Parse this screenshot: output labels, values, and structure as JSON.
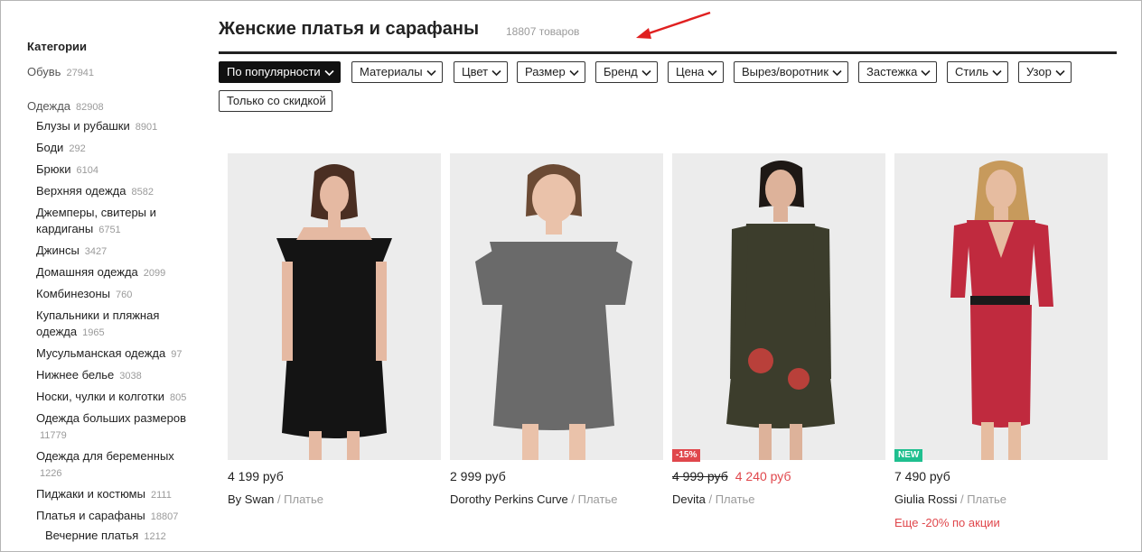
{
  "sidebar": {
    "title": "Категории",
    "items": [
      {
        "label": "Обувь",
        "count": "27941"
      },
      {
        "label": "Одежда",
        "count": "82908"
      },
      {
        "label": "Блузы и рубашки",
        "count": "8901"
      },
      {
        "label": "Боди",
        "count": "292"
      },
      {
        "label": "Брюки",
        "count": "6104"
      },
      {
        "label": "Верхняя одежда",
        "count": "8582"
      },
      {
        "label": "Джемперы, свитеры и",
        "label2": "кардиганы",
        "count": "6751"
      },
      {
        "label": "Джинсы",
        "count": "3427"
      },
      {
        "label": "Домашняя одежда",
        "count": "2099"
      },
      {
        "label": "Комбинезоны",
        "count": "760"
      },
      {
        "label": "Купальники и пляжная",
        "label2": "одежда",
        "count": "1965"
      },
      {
        "label": "Мусульманская одежда",
        "count": "97"
      },
      {
        "label": "Нижнее белье",
        "count": "3038"
      },
      {
        "label": "Носки, чулки и колготки",
        "count": "805"
      },
      {
        "label": "Одежда больших размеров",
        "count": "11779"
      },
      {
        "label": "Одежда для беременных",
        "count": "1226"
      },
      {
        "label": "Пиджаки и костюмы",
        "count": "2111"
      },
      {
        "label": "Платья и сарафаны",
        "count": "18807"
      },
      {
        "label": "Вечерние платья",
        "count": "1212"
      }
    ]
  },
  "header": {
    "title": "Женские платья и сарафаны",
    "count": "18807 товаров"
  },
  "filters": [
    {
      "label": "По популярности",
      "active": true
    },
    {
      "label": "Материалы"
    },
    {
      "label": "Цвет"
    },
    {
      "label": "Размер"
    },
    {
      "label": "Бренд"
    },
    {
      "label": "Цена"
    },
    {
      "label": "Вырез/воротник"
    },
    {
      "label": "Застежка"
    },
    {
      "label": "Стиль"
    },
    {
      "label": "Узор"
    },
    {
      "label": "Только со скидкой"
    }
  ],
  "products": [
    {
      "price": "4 199 руб",
      "brand": "By Swan",
      "type": "/ Платье",
      "dress_color": "#141414"
    },
    {
      "price": "2 999 руб",
      "brand": "Dorothy Perkins Curve",
      "type": "/ Платье",
      "dress_color": "#6a6a6a"
    },
    {
      "price_old": "4 999 руб",
      "price_new": "4 240 руб",
      "brand": "Devita",
      "type": "/ Платье",
      "badge": "-15%",
      "dress_color": "#3c3d2c"
    },
    {
      "price": "7 490 руб",
      "brand": "Giulia Rossi",
      "type": "/ Платье",
      "badge": "NEW",
      "promo": "Еще -20% по акции",
      "dress_color": "#c02a3e"
    }
  ],
  "colors": {
    "accent_red": "#e0474c",
    "new_badge": "#1fbf8f",
    "annotation_arrow": "#e02020"
  }
}
